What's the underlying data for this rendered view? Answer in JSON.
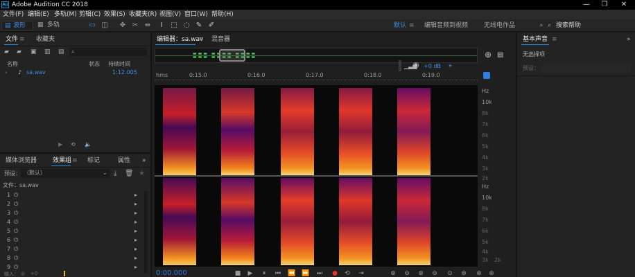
{
  "app": {
    "title": "Adobe Audition CC 2018",
    "logo_text": "Au"
  },
  "window_controls": [
    "—",
    "❐",
    "✕"
  ],
  "menu": [
    "文件(F)",
    "编辑(E)",
    "多轨(M)",
    "剪辑(C)",
    "效果(S)",
    "收藏夹(R)",
    "视图(V)",
    "窗口(W)",
    "帮助(H)"
  ],
  "toolbar": {
    "waveform_label": "波形",
    "multitrack_label": "多轨",
    "workspace_default": "默认",
    "workspace_video": "编辑音频到视频",
    "workspace_radio": "无线电作品",
    "search_label": "搜索帮助"
  },
  "files_panel": {
    "tabs": [
      "文件",
      "收藏夹"
    ],
    "columns": {
      "name": "名称",
      "state": "状态",
      "duration": "持续时间"
    },
    "files": [
      {
        "name": "sa.wav",
        "duration": "1:12.005"
      }
    ]
  },
  "effects_panel": {
    "tabs": [
      "媒体浏览器",
      "效果组",
      "标记",
      "属性"
    ],
    "preset_label": "预设：",
    "preset_value": "（默认）",
    "file_label": "文件：sa.wav",
    "slots": [
      "1",
      "2",
      "3",
      "4",
      "5",
      "6",
      "7",
      "8",
      "9"
    ],
    "input_label": "输入：",
    "input_value": "+0"
  },
  "editor": {
    "tabs": [
      "编辑器：sa.wav",
      "混音器"
    ],
    "volume": "+0 dB",
    "ruler_unit": "hms",
    "ruler_ticks": [
      "0:15.0",
      "0:16.0",
      "0:17.0",
      "0:18.0",
      "0:19.0"
    ],
    "freq_labels_top": [
      "Hz",
      "10k",
      "8k",
      "7k",
      "6k",
      "5k",
      "4k",
      "3k",
      "2k"
    ],
    "freq_labels_bottom": [
      "Hz",
      "10k",
      "8k",
      "7k",
      "6k",
      "5k",
      "4k",
      "3k",
      "2k"
    ],
    "time_display": "0:00.000"
  },
  "essential_sound": {
    "title": "基本声音",
    "no_selection": "无选择项",
    "preset_label": "预设："
  }
}
